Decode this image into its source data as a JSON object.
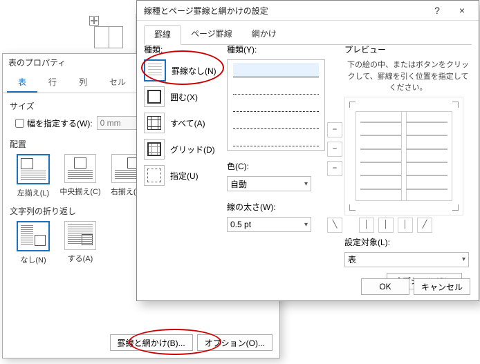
{
  "table_props": {
    "title": "表のプロパティ",
    "tabs": [
      "表",
      "行",
      "列",
      "セル"
    ],
    "size_label": "サイズ",
    "width_check_label": "幅を指定する(W):",
    "width_value": "0 mm",
    "align_label": "配置",
    "align_opts": [
      "左揃え(L)",
      "中央揃え(C)",
      "右揃え(H)"
    ],
    "wrap_label": "文字列の折り返し",
    "wrap_opts": [
      "なし(N)",
      "する(A)"
    ],
    "borders_btn": "罫線と網かけ(B)...",
    "options_btn": "オプション(O)..."
  },
  "borders": {
    "title": "線種とページ罫線と網かけの設定",
    "help": "?",
    "close": "×",
    "tabs": [
      "罫線",
      "ページ罫線",
      "網かけ"
    ],
    "kind_label": "種類:",
    "kinds": [
      "罫線なし(N)",
      "囲む(X)",
      "すべて(A)",
      "グリッド(D)",
      "指定(U)"
    ],
    "style_label": "種類(Y):",
    "color_label": "色(C):",
    "color_value": "自動",
    "weight_label": "線の太さ(W):",
    "weight_value": "0.5 pt",
    "preview_label": "プレビュー",
    "preview_hint": "下の絵の中、またはボタンをクリックして、罫線を引く位置を指定してください。",
    "apply_label": "設定対象(L):",
    "apply_value": "表",
    "options_btn": "オプション(O)...",
    "ok": "OK",
    "cancel": "キャンセル"
  }
}
